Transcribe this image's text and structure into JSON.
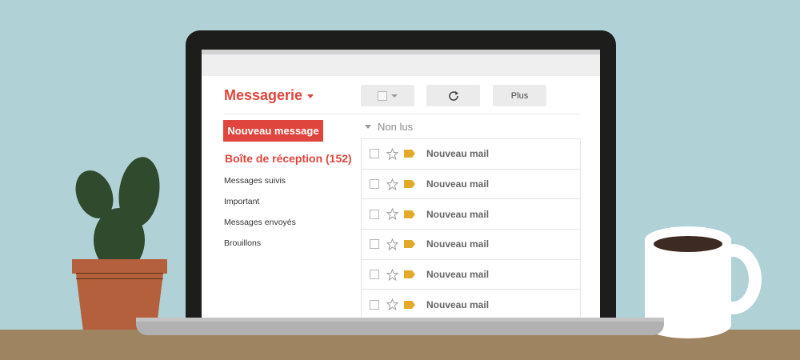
{
  "app": {
    "title": "Messagerie"
  },
  "toolbar": {
    "more_label": "Plus"
  },
  "sidebar": {
    "compose_label": "Nouveau message",
    "inbox_label": "Boîte de réception (152)",
    "items": [
      {
        "label": "Messages suivis"
      },
      {
        "label": "Important"
      },
      {
        "label": "Messages envoyés"
      },
      {
        "label": "Brouillons"
      }
    ]
  },
  "mail": {
    "section_label": "Non lus",
    "rows": [
      {
        "subject": "Nouveau mail"
      },
      {
        "subject": "Nouveau mail"
      },
      {
        "subject": "Nouveau mail"
      },
      {
        "subject": "Nouveau mail"
      },
      {
        "subject": "Nouveau mail"
      },
      {
        "subject": "Nouveau mail"
      }
    ]
  },
  "colors": {
    "background": "#b0d1d6",
    "accent": "#e0453d",
    "label_tag": "#e2a92a",
    "desk": "#9f8461",
    "laptop": "#1d1d1b"
  },
  "icons": [
    "caret-down-icon",
    "checkbox-icon",
    "refresh-icon",
    "star-icon",
    "label-tag-icon"
  ]
}
